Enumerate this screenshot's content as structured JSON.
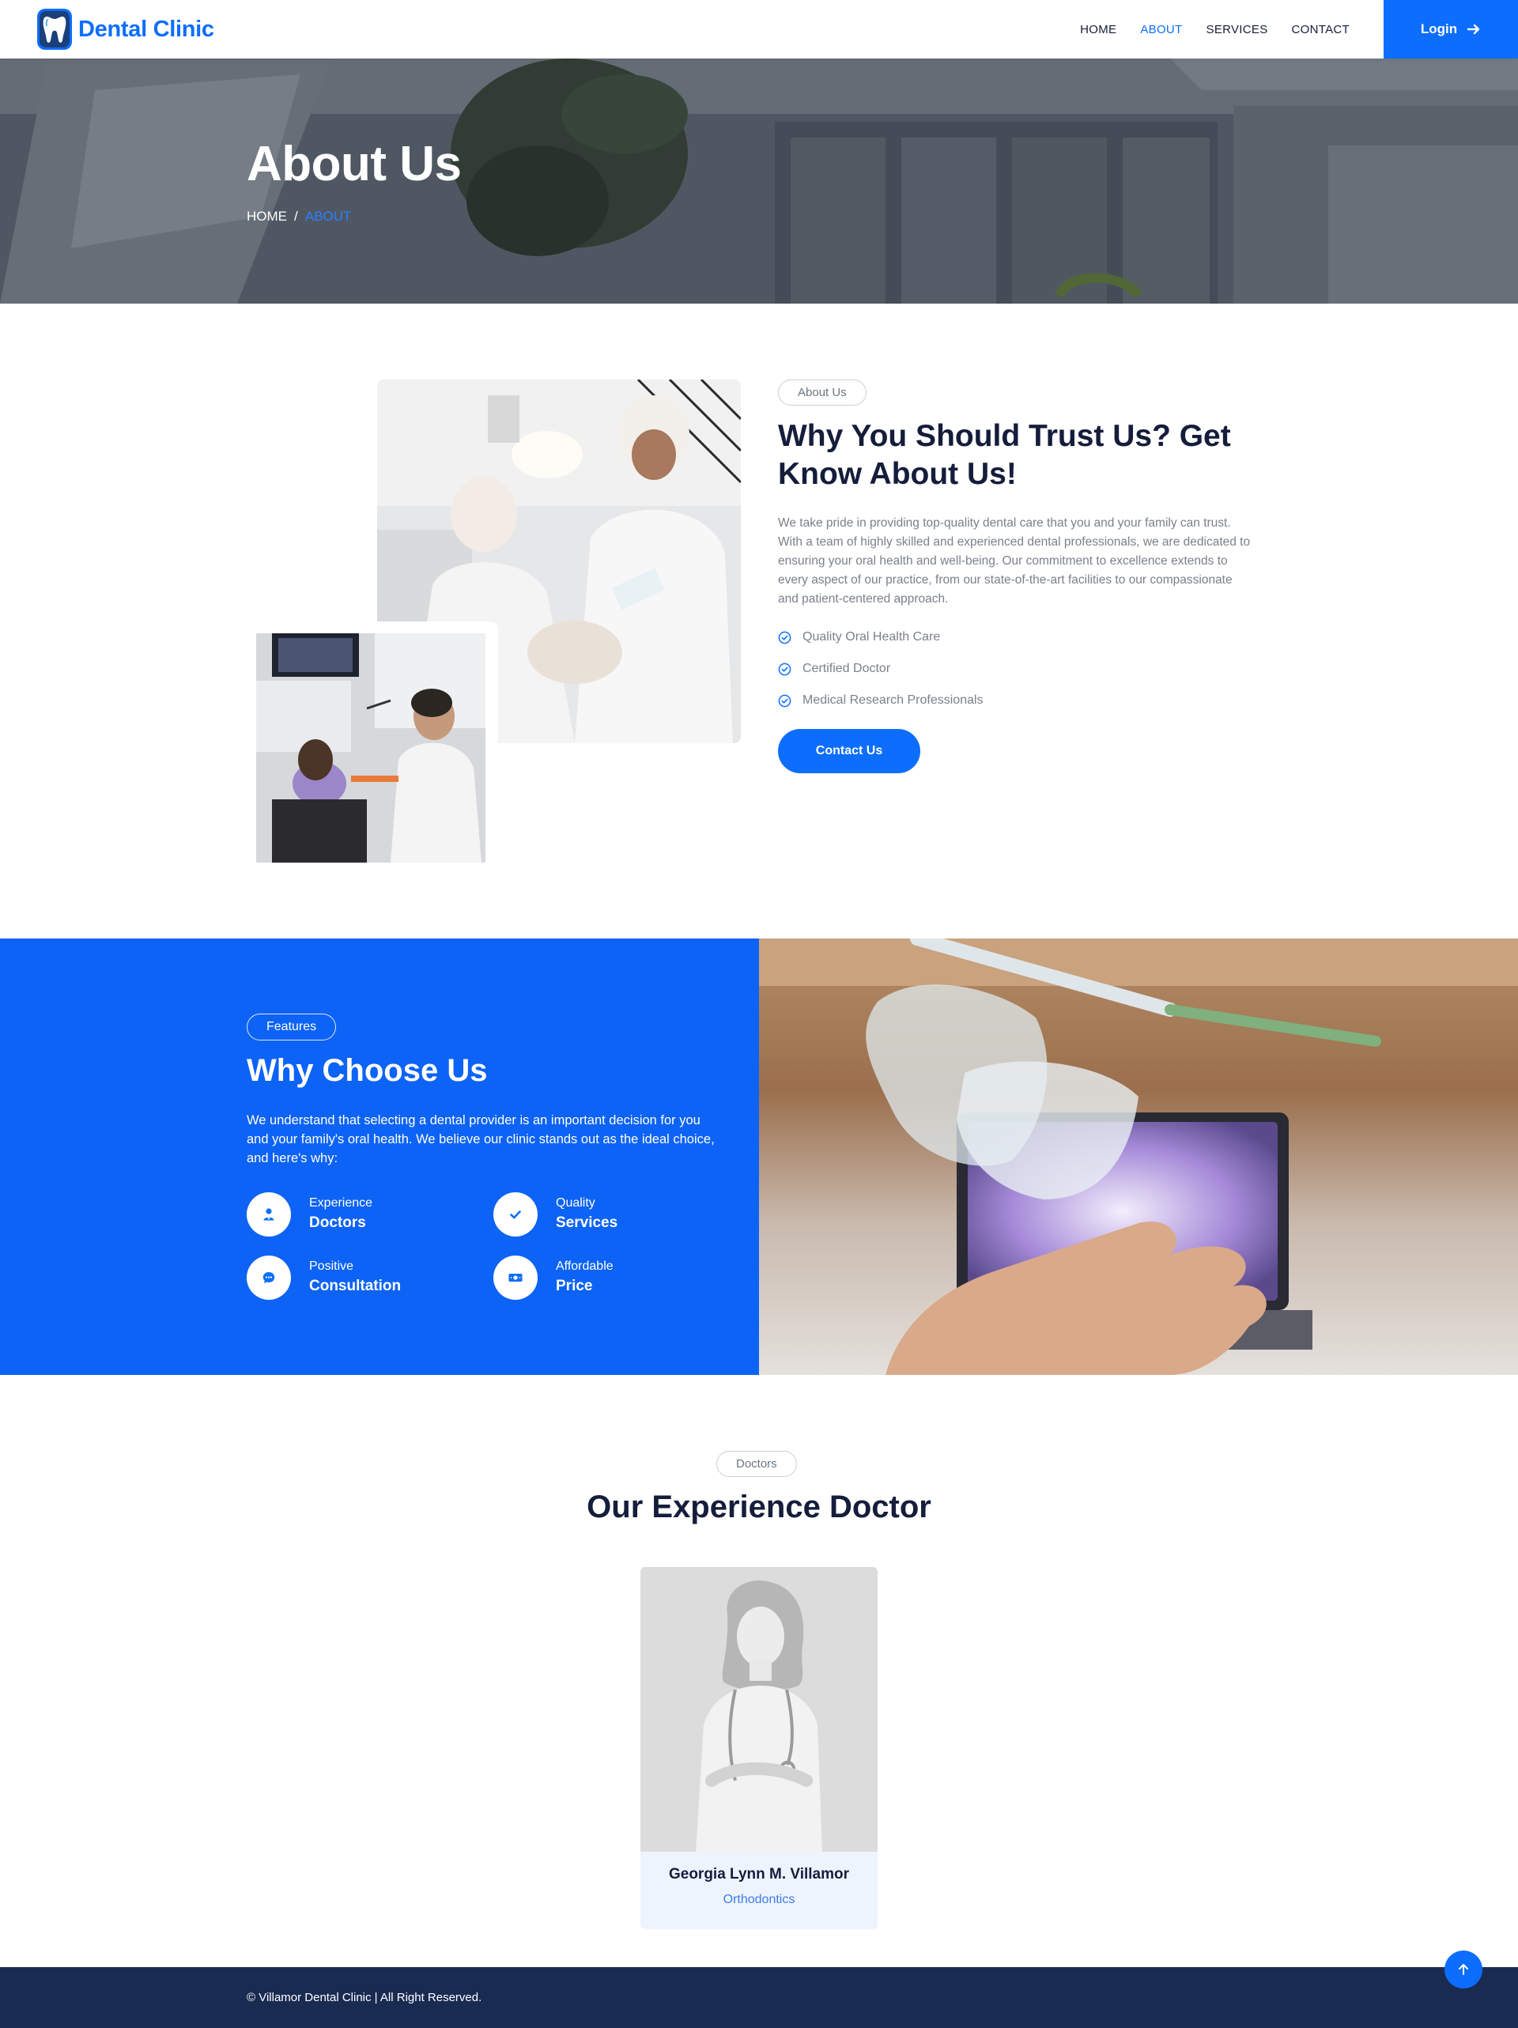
{
  "brand": {
    "name": "Dental Clinic",
    "logo_icon": "tooth-logo-icon"
  },
  "nav": {
    "items": [
      {
        "label": "HOME",
        "active": false
      },
      {
        "label": "ABOUT",
        "active": true
      },
      {
        "label": "SERVICES",
        "active": false
      },
      {
        "label": "CONTACT",
        "active": false
      }
    ],
    "login_label": "Login",
    "login_icon": "arrow-right-icon"
  },
  "hero": {
    "title": "About Us",
    "breadcrumb": {
      "home": "HOME",
      "separator": "/",
      "current": "ABOUT"
    }
  },
  "about": {
    "badge": "About Us",
    "title": "Why You Should Trust Us? Get Know About Us!",
    "description": "We take pride in providing top-quality dental care that you and your family can trust. With a team of highly skilled and experienced dental professionals, we are dedicated to ensuring your oral health and well-being. Our commitment to excellence extends to every aspect of our practice, from our state-of-the-art facilities to our compassionate and patient-centered approach.",
    "checklist": [
      "Quality Oral Health Care",
      "Certified Doctor",
      "Medical Research Professionals"
    ],
    "cta_label": "Contact Us"
  },
  "features": {
    "badge": "Features",
    "title": "Why Choose Us",
    "description": "We understand that selecting a dental provider is an important decision for you and your family's oral health. We believe our clinic stands out as the ideal choice, and here's why:",
    "items": [
      {
        "small": "Experience",
        "big": "Doctors",
        "icon": "doctor-icon"
      },
      {
        "small": "Quality",
        "big": "Services",
        "icon": "check-icon"
      },
      {
        "small": "Positive",
        "big": "Consultation",
        "icon": "chat-icon"
      },
      {
        "small": "Affordable",
        "big": "Price",
        "icon": "money-icon"
      }
    ]
  },
  "doctors": {
    "badge": "Doctors",
    "title": "Our Experience Doctor",
    "list": [
      {
        "name": "Georgia Lynn M. Villamor",
        "specialty": "Orthodontics"
      }
    ]
  },
  "footer": {
    "copyright": "© Villamor Dental Clinic | All Right Reserved."
  },
  "colors": {
    "primary": "#0d6efd",
    "navy": "#151d3b",
    "footer_bg": "#1a2b52",
    "features_bg": "#0d63f5"
  }
}
